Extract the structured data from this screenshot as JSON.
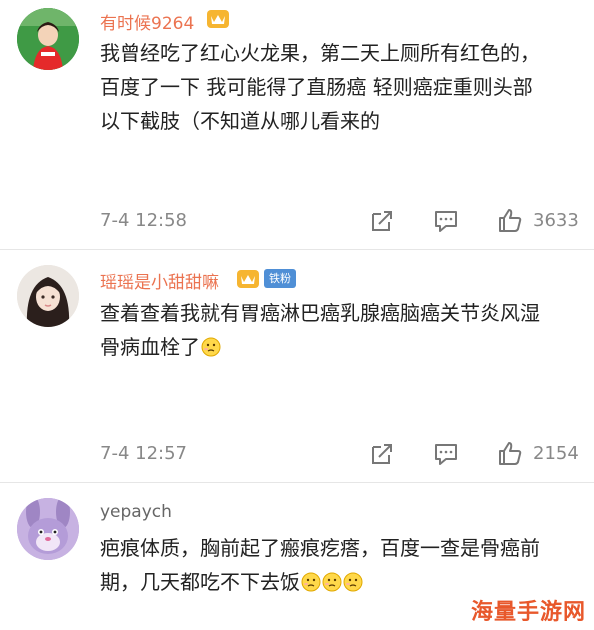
{
  "comments": [
    {
      "username": "有时候9264",
      "text_lines": [
        "我曾经吃了红心火龙果，第二天上厕所有红色的，",
        "百度了一下 我可能得了直肠癌 轻则癌症重则头部",
        "以下截肢（不知道从哪儿看来的"
      ],
      "time": "7-4 12:58",
      "likes": "3633"
    },
    {
      "username": "瑶瑶是小甜甜嘛",
      "fan_badge": "铁粉",
      "text_lines": [
        "查着查着我就有胃癌淋巴癌乳腺癌脑癌关节炎风湿",
        "骨病血栓了"
      ],
      "time": "7-4 12:57",
      "likes": "2154"
    },
    {
      "username": "yepaych",
      "text_lines": [
        "疤痕体质，胸前起了瘢痕疙瘩，百度一查是骨癌前",
        "期，几天都吃不下去饭"
      ]
    }
  ],
  "watermark": "海量手游网",
  "icons": [
    "avatar",
    "vip-crown-icon",
    "share-icon",
    "comment-icon",
    "like-icon",
    "emoji-icon"
  ],
  "colors": {
    "username": "#eb7350",
    "fan_badge": "#4f8fd6",
    "meta": "#888888"
  }
}
